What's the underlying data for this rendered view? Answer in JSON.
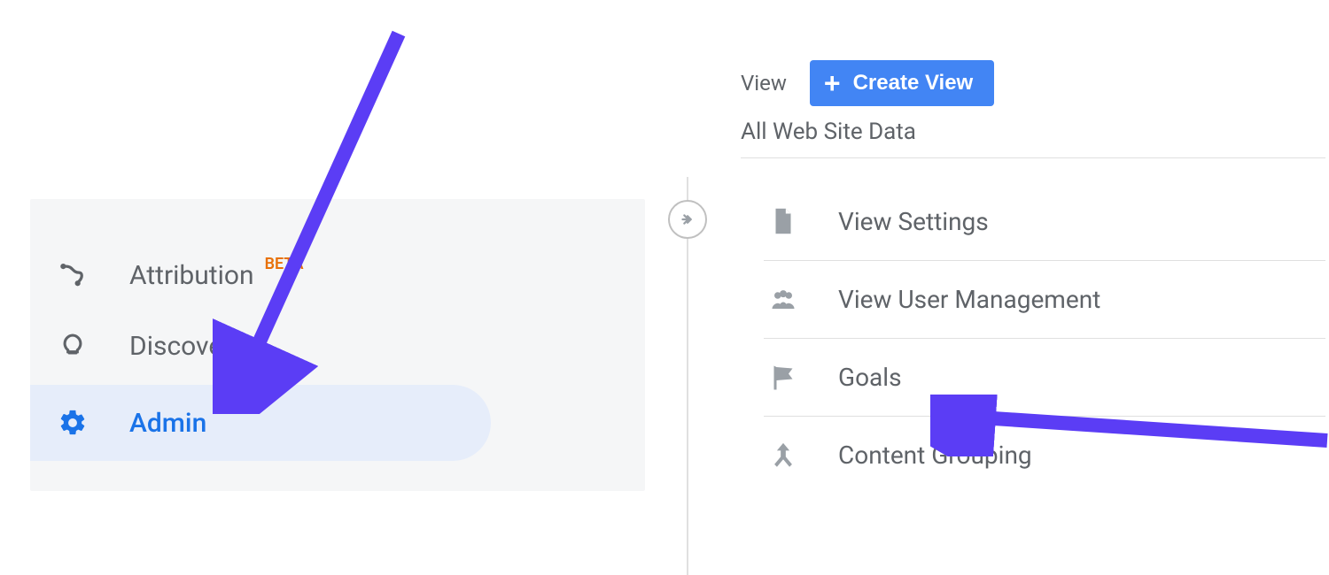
{
  "leftNav": {
    "items": [
      {
        "label": "Attribution",
        "badge": "BETA",
        "icon": "attribution"
      },
      {
        "label": "Discover",
        "badge": null,
        "icon": "discover"
      },
      {
        "label": "Admin",
        "badge": null,
        "icon": "admin",
        "selected": true
      }
    ]
  },
  "rightPanel": {
    "viewLabel": "View",
    "createView": "Create View",
    "subtitle": "All Web Site Data",
    "menu": [
      {
        "label": "View Settings",
        "icon": "file"
      },
      {
        "label": "View User Management",
        "icon": "users"
      },
      {
        "label": "Goals",
        "icon": "flag"
      },
      {
        "label": "Content Grouping",
        "icon": "group-arrow"
      }
    ]
  }
}
